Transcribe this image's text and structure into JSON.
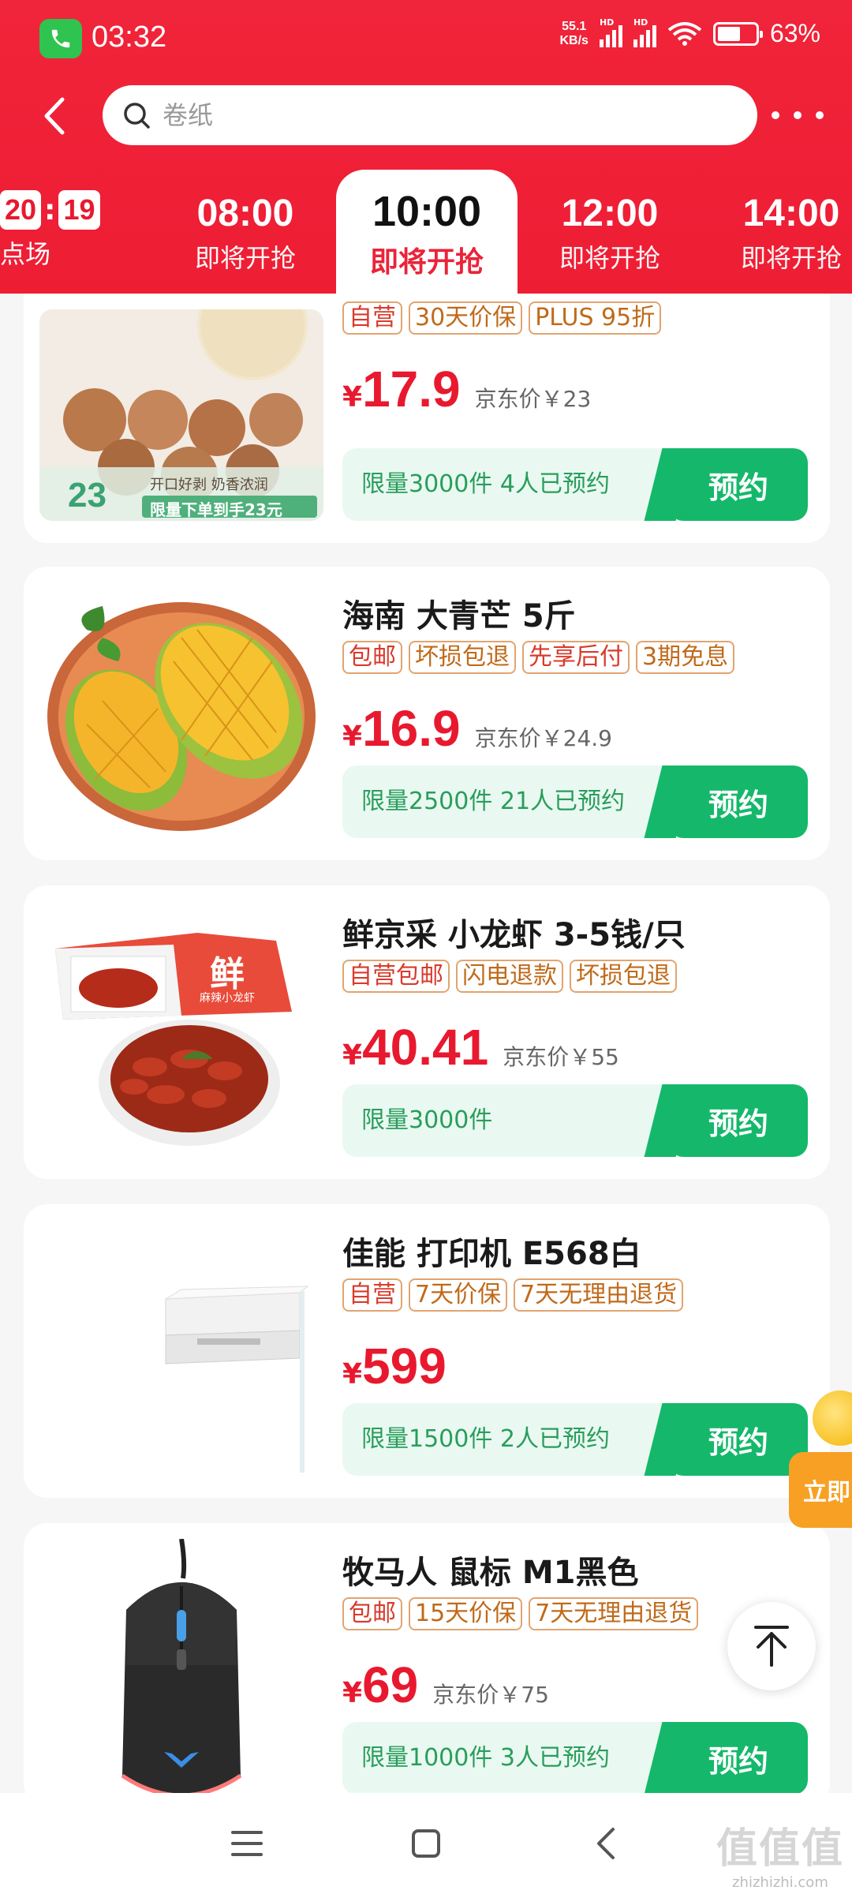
{
  "status_bar": {
    "time": "03:32",
    "net_speed_value": "55.1",
    "net_speed_unit": "KB/s",
    "signal_label_1": "HD",
    "signal_label_2": "HD",
    "battery_percent": "63%"
  },
  "search": {
    "placeholder": "卷纸"
  },
  "time_tabs": {
    "current": {
      "hours": "20",
      "minutes": "19",
      "sub": "点场"
    },
    "tabs": [
      {
        "time": "08:00",
        "status": "即将开抢"
      },
      {
        "time": "10:00",
        "status": "即将开抢",
        "active": true
      },
      {
        "time": "12:00",
        "status": "即将开抢"
      },
      {
        "time": "14:00",
        "status": "即将开抢"
      }
    ]
  },
  "products": [
    {
      "title": "",
      "tags": [
        "自营",
        "30天价保",
        "PLUS 95折"
      ],
      "price_symbol": "¥",
      "price": "17.9",
      "jd_price": "京东价￥23",
      "quota": "限量3000件 4人已预约",
      "button": "预约",
      "image_text_1": "开口好剥 奶香浓润",
      "image_text_2": "限量下单到手23元",
      "image_badge": "23"
    },
    {
      "title": "海南 大青芒 5斤",
      "tags": [
        "包邮",
        "坏损包退",
        "先享后付",
        "3期免息"
      ],
      "price_symbol": "¥",
      "price": "16.9",
      "jd_price": "京东价￥24.9",
      "quota": "限量2500件 21人已预约",
      "button": "预约"
    },
    {
      "title": "鲜京采 小龙虾 3-5钱/只",
      "tags": [
        "自营包邮",
        "闪电退款",
        "坏损包退"
      ],
      "price_symbol": "¥",
      "price": "40.41",
      "jd_price": "京东价￥55",
      "quota": "限量3000件",
      "button": "预约",
      "image_text_1": "鲜",
      "image_text_2": "麻辣小龙虾"
    },
    {
      "title": "佳能 打印机 E568白",
      "tags": [
        "自营",
        "7天价保",
        "7天无理由退货"
      ],
      "price_symbol": "¥",
      "price": "599",
      "jd_price": "",
      "quota": "限量1500件 2人已预约",
      "button": "预约"
    },
    {
      "title": "牧马人 鼠标 M1黑色",
      "tags": [
        "包邮",
        "15天价保",
        "7天无理由退货"
      ],
      "price_symbol": "¥",
      "price": "69",
      "jd_price": "京东价￥75",
      "quota": "限量1000件 3人已预约",
      "button": "预约"
    }
  ],
  "floating": {
    "promo_label": "立即"
  },
  "watermark": {
    "line1": "值值值",
    "line2": "zhizhizhi.com"
  },
  "colors": {
    "header_red": "#ee1d34",
    "price_red": "#e8192f",
    "reserve_green": "#15b86b",
    "quota_bg": "#e9f9f1"
  }
}
